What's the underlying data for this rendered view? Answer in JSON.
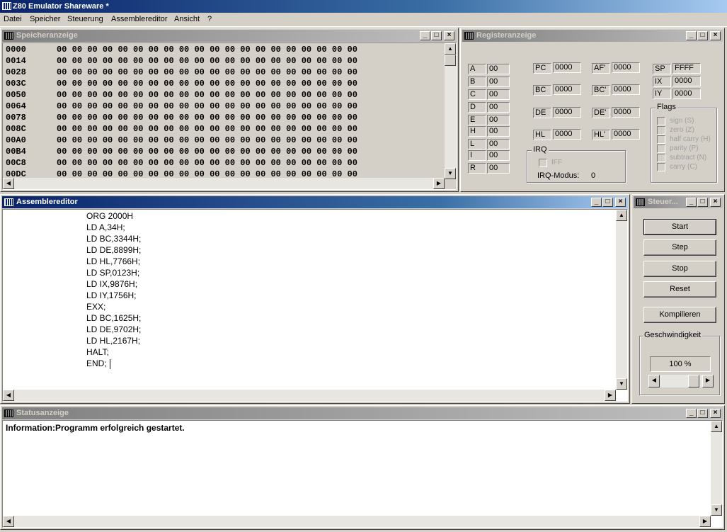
{
  "app": {
    "title": "Z80 Emulator Shareware *"
  },
  "menu": [
    "Datei",
    "Speicher",
    "Steuerung",
    "Assemblereditor",
    "Ansicht",
    "?"
  ],
  "memory": {
    "title": "Speicheranzeige",
    "rows": [
      {
        "addr": "0000",
        "bytes": "00 00 00 00 00 00 00 00 00 00 00 00 00 00 00 00 00 00 00 00"
      },
      {
        "addr": "0014",
        "bytes": "00 00 00 00 00 00 00 00 00 00 00 00 00 00 00 00 00 00 00 00"
      },
      {
        "addr": "0028",
        "bytes": "00 00 00 00 00 00 00 00 00 00 00 00 00 00 00 00 00 00 00 00"
      },
      {
        "addr": "003C",
        "bytes": "00 00 00 00 00 00 00 00 00 00 00 00 00 00 00 00 00 00 00 00"
      },
      {
        "addr": "0050",
        "bytes": "00 00 00 00 00 00 00 00 00 00 00 00 00 00 00 00 00 00 00 00"
      },
      {
        "addr": "0064",
        "bytes": "00 00 00 00 00 00 00 00 00 00 00 00 00 00 00 00 00 00 00 00"
      },
      {
        "addr": "0078",
        "bytes": "00 00 00 00 00 00 00 00 00 00 00 00 00 00 00 00 00 00 00 00"
      },
      {
        "addr": "008C",
        "bytes": "00 00 00 00 00 00 00 00 00 00 00 00 00 00 00 00 00 00 00 00"
      },
      {
        "addr": "00A0",
        "bytes": "00 00 00 00 00 00 00 00 00 00 00 00 00 00 00 00 00 00 00 00"
      },
      {
        "addr": "00B4",
        "bytes": "00 00 00 00 00 00 00 00 00 00 00 00 00 00 00 00 00 00 00 00"
      },
      {
        "addr": "00C8",
        "bytes": "00 00 00 00 00 00 00 00 00 00 00 00 00 00 00 00 00 00 00 00"
      },
      {
        "addr": "00DC",
        "bytes": "00 00 00 00 00 00 00 00 00 00 00 00 00 00 00 00 00 00 00 00"
      }
    ]
  },
  "registers": {
    "title": "Registeranzeige",
    "eight_bit": [
      {
        "name": "A",
        "value": "00"
      },
      {
        "name": "B",
        "value": "00"
      },
      {
        "name": "C",
        "value": "00"
      },
      {
        "name": "D",
        "value": "00"
      },
      {
        "name": "E",
        "value": "00"
      },
      {
        "name": "H",
        "value": "00"
      },
      {
        "name": "L",
        "value": "00"
      },
      {
        "name": "I",
        "value": "00"
      },
      {
        "name": "R",
        "value": "00"
      }
    ],
    "pairs": [
      {
        "name": "PC",
        "value": "0000"
      },
      {
        "name": "BC",
        "value": "0000"
      },
      {
        "name": "DE",
        "value": "0000"
      },
      {
        "name": "HL",
        "value": "0000"
      }
    ],
    "alt_pairs": [
      {
        "name": "AF'",
        "value": "0000"
      },
      {
        "name": "BC'",
        "value": "0000"
      },
      {
        "name": "DE'",
        "value": "0000"
      },
      {
        "name": "HL'",
        "value": "0000"
      }
    ],
    "index": [
      {
        "name": "SP",
        "value": "FFFF"
      },
      {
        "name": "IX",
        "value": "0000"
      },
      {
        "name": "IY",
        "value": "0000"
      }
    ],
    "irq": {
      "title": "IRQ",
      "iff_label": "IFF",
      "mode_label": "IRQ-Modus:",
      "mode_value": "0"
    },
    "flags": {
      "title": "Flags",
      "items": [
        "sign (S)",
        "zero (Z)",
        "half carry (H)",
        "parity (P)",
        "subtract (N)",
        "carry (C)"
      ]
    }
  },
  "editor": {
    "title": "Assemblereditor",
    "lines": [
      "ORG 2000H",
      "LD A,34H;",
      "LD BC,3344H;",
      "LD DE,8899H;",
      "LD HL,7766H;",
      "LD SP,0123H;",
      "LD IX,9876H;",
      "LD IY,1756H;",
      "EXX;",
      "LD BC,1625H;",
      "LD DE,9702H;",
      "LD HL,2167H;",
      "HALT;",
      "END;"
    ]
  },
  "control": {
    "title": "Steuer...",
    "start": "Start",
    "step": "Step",
    "stop": "Stop",
    "reset": "Reset",
    "compile": "Kompilieren",
    "speed_title": "Geschwindigkeit",
    "speed_value": "100 %"
  },
  "status": {
    "title": "Statusanzeige",
    "message": "Information:Programm erfolgreich gestartet."
  }
}
